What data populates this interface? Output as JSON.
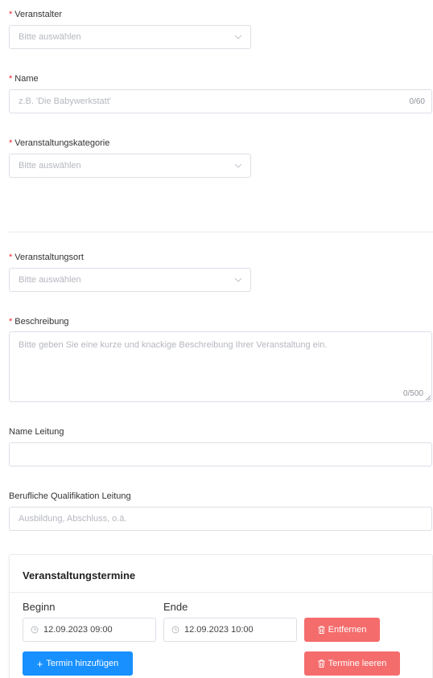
{
  "form": {
    "veranstalter": {
      "label": "Veranstalter",
      "required": "*",
      "placeholder": "Bitte auswählen"
    },
    "name": {
      "label": "Name",
      "required": "*",
      "placeholder": "z.B. 'Die Babywerkstatt'",
      "counter": "0/60"
    },
    "kategorie": {
      "label": "Veranstaltungskategorie",
      "required": "*",
      "placeholder": "Bitte auswählen"
    },
    "ort": {
      "label": "Veranstaltungsort",
      "required": "*",
      "placeholder": "Bitte auswählen"
    },
    "beschreibung": {
      "label": "Beschreibung",
      "required": "*",
      "placeholder": "Bitte geben Sie eine kurze und knackige Beschreibung Ihrer Veranstaltung ein.",
      "counter": "0/500"
    },
    "leitung": {
      "label": "Name Leitung",
      "value": ""
    },
    "qualifikation": {
      "label": "Berufliche Qualifikation Leitung",
      "placeholder": "Ausbildung, Abschluss, o.ä."
    }
  },
  "termine": {
    "title": "Veranstaltungstermine",
    "beginn_label": "Beginn",
    "ende_label": "Ende",
    "beginn_value": "12.09.2023 09:00",
    "ende_value": "12.09.2023 10:00",
    "remove_label": "Entfernen",
    "add_label": "Termin hinzufügen",
    "clear_label": "Termine leeren"
  },
  "colors": {
    "required": "#f5222d",
    "danger": "#f56c6c",
    "primary": "#1890ff"
  }
}
